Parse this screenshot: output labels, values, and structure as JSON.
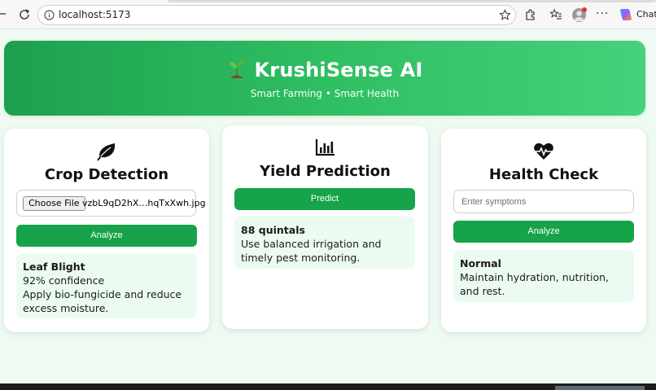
{
  "browser": {
    "url": "localhost:5173",
    "chat_label": "Chat"
  },
  "header": {
    "title": "KrushiSense AI",
    "subtitle": "Smart Farming • Smart Health"
  },
  "cards": {
    "crop": {
      "title": "Crop Detection",
      "choose_file_label": "Choose File",
      "file_name": "vzbL9qD2hX…hqTxXwh.jpg",
      "button_label": "Analyze",
      "result": {
        "label": "Leaf Blight",
        "confidence": "92% confidence",
        "advice": "Apply bio-fungicide and reduce excess moisture."
      }
    },
    "yield": {
      "title": "Yield Prediction",
      "button_label": "Predict",
      "result": {
        "label": "88 quintals",
        "advice": "Use balanced irrigation and timely pest monitoring."
      }
    },
    "health": {
      "title": "Health Check",
      "input_placeholder": "Enter symptoms",
      "button_label": "Analyze",
      "result": {
        "label": "Normal",
        "advice": "Maintain hydration, nutrition, and rest."
      }
    }
  },
  "colors": {
    "primary_green": "#16a34a",
    "result_bg": "#ecfbf1",
    "page_bg": "#eefaf2"
  }
}
